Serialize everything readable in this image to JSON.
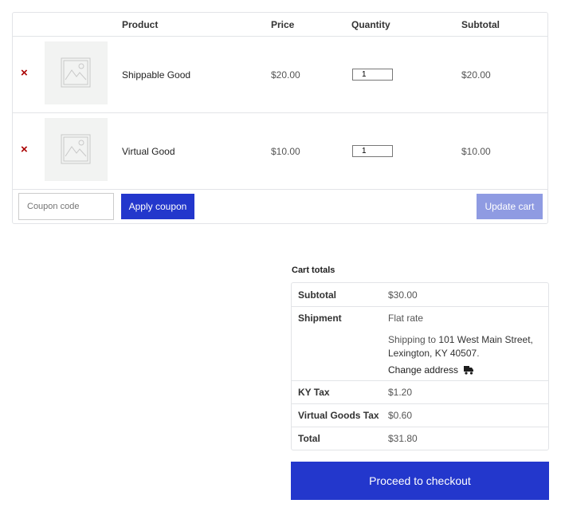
{
  "cart": {
    "headers": {
      "product": "Product",
      "price": "Price",
      "quantity": "Quantity",
      "subtotal": "Subtotal"
    },
    "items": [
      {
        "name": "Shippable Good",
        "price": "$20.00",
        "quantity": "1",
        "subtotal": "$20.00",
        "remove": "×"
      },
      {
        "name": "Virtual Good",
        "price": "$10.00",
        "quantity": "1",
        "subtotal": "$10.00",
        "remove": "×"
      }
    ],
    "coupon_placeholder": "Coupon code",
    "apply_coupon": "Apply coupon",
    "update_cart": "Update cart"
  },
  "totals": {
    "title": "Cart totals",
    "subtotal_label": "Subtotal",
    "subtotal_value": "$30.00",
    "shipment_label": "Shipment",
    "shipment_method": "Flat rate",
    "shipping_to_prefix": "Shipping to",
    "shipping_address": "101 West Main Street, Lexington, KY 40507",
    "change_address": "Change address",
    "ky_tax_label": "KY Tax",
    "ky_tax_value": "$1.20",
    "virtual_tax_label": "Virtual Goods Tax",
    "virtual_tax_value": "$0.60",
    "total_label": "Total",
    "total_value": "$31.80"
  },
  "checkout_button": "Proceed to checkout",
  "colors": {
    "accent": "#2337cc",
    "update_button": "#8f9be2",
    "remove": "#aa0000"
  },
  "icons": {
    "remove": "close-icon",
    "placeholder": "image-placeholder-icon",
    "truck": "truck-icon"
  }
}
